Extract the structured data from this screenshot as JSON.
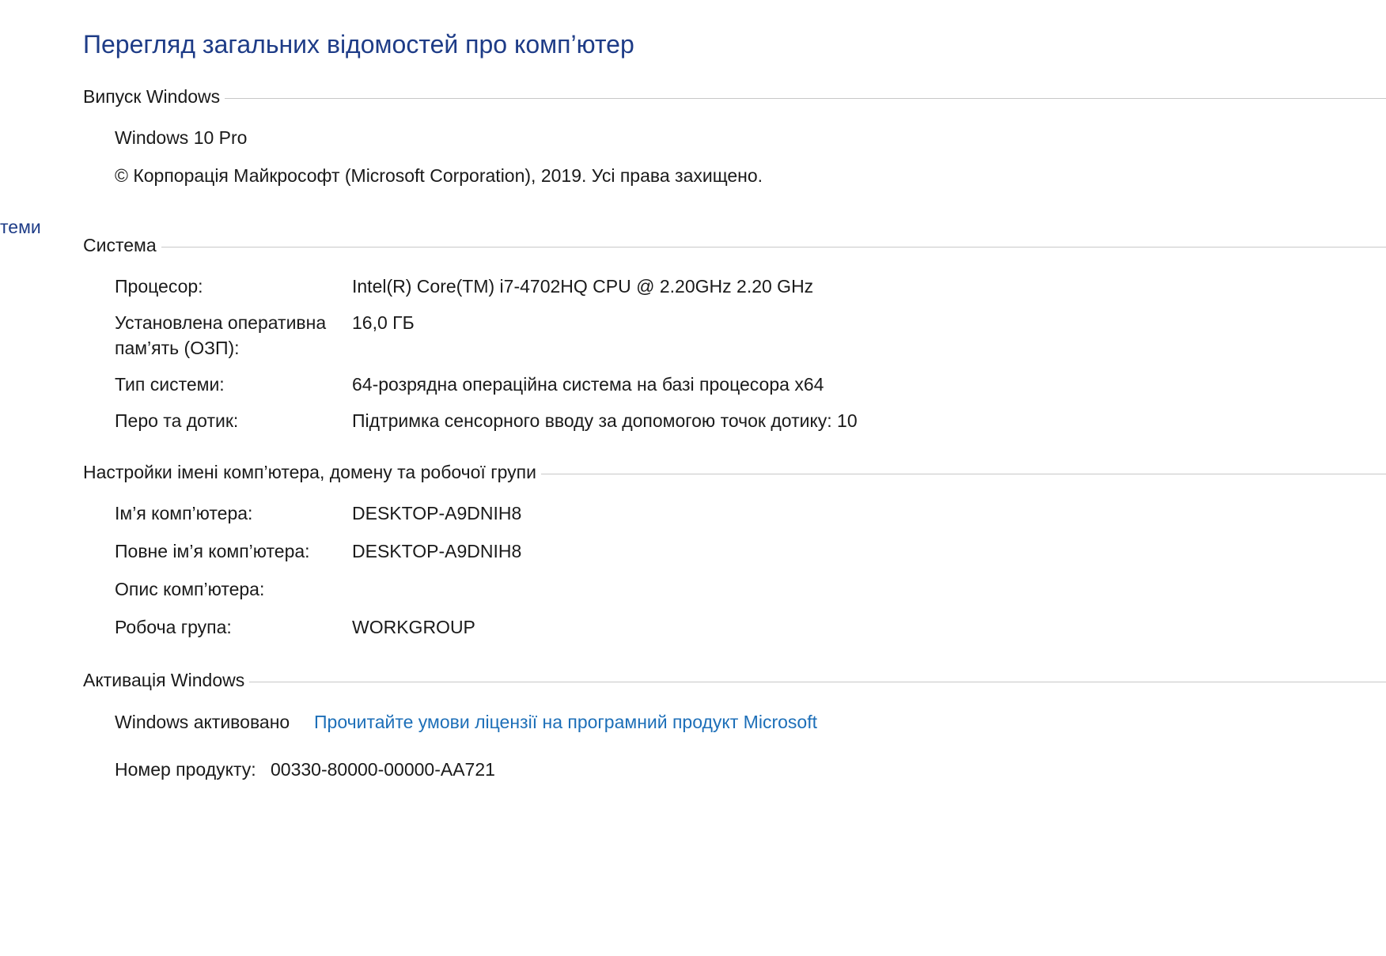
{
  "header": {
    "title": "Перегляд загальних відомостей про комп’ютер"
  },
  "left_nav": {
    "partial_item": "теми"
  },
  "edition": {
    "section_title": "Випуск Windows",
    "name": "Windows 10 Pro",
    "copyright": "© Корпорація Майкрософт (Microsoft Corporation), 2019. Усі права захищено."
  },
  "system": {
    "section_title": "Система",
    "rows": [
      {
        "label": "Процесор:",
        "value": "Intel(R) Core(TM) i7-4702HQ CPU @ 2.20GHz   2.20 GHz"
      },
      {
        "label": "Установлена оперативна",
        "label2": "пам’ять (ОЗП):",
        "value": "16,0 ГБ"
      },
      {
        "label": "Тип системи:",
        "value": "64-розрядна операційна система на базі процесора x64"
      },
      {
        "label": "Перо та дотик:",
        "value": "Підтримка сенсорного вводу за допомогою точок дотику: 10"
      }
    ]
  },
  "computer_name": {
    "section_title": "Настройки імені комп’ютера, домену та робочої групи",
    "rows": [
      {
        "label": "Ім’я комп’ютера:",
        "value": "DESKTOP-A9DNIH8"
      },
      {
        "label": "Повне ім’я комп’ютера:",
        "value": "DESKTOP-A9DNIH8"
      },
      {
        "label": "Опис комп’ютера:",
        "value": ""
      },
      {
        "label": "Робоча група:",
        "value": "WORKGROUP"
      }
    ]
  },
  "activation": {
    "section_title": "Активація Windows",
    "status": "Windows активовано",
    "license_link": "Прочитайте умови ліцензії на програмний продукт Microsoft",
    "product_id_label": "Номер продукту:",
    "product_id": "00330-80000-00000-AA721"
  },
  "colors": {
    "title": "#1e3c87",
    "link": "#1d6fb8",
    "rule": "#c8c8c8"
  }
}
